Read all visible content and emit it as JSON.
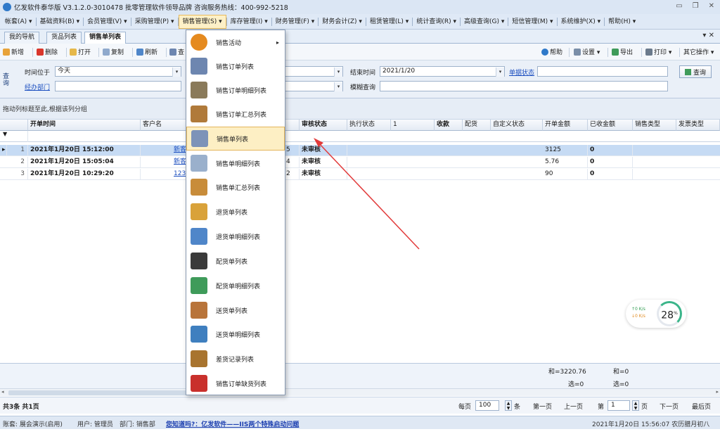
{
  "window": {
    "title": "亿发软件泰华版 V3.1.2.0-3010478 批零管理软件领导品牌 咨询服务热线：400-992-5218"
  },
  "menubar": {
    "items": [
      "帐套(A) ▾",
      "基础资料(B) ▾",
      "会员管理(V) ▾",
      "采购管理(P) ▾",
      "销售管理(S) ▾",
      "库存管理(I) ▾",
      "财务管理(F) ▾",
      "财务会计(Z) ▾",
      "租赁管理(L) ▾",
      "统计查询(R) ▾",
      "高级查询(G) ▾",
      "短信管理(M) ▾",
      "系统维护(X) ▾",
      "帮助(H) ▾"
    ]
  },
  "tabs": [
    "我的导航",
    "货品列表",
    "销售单列表"
  ],
  "toolbar": {
    "new": "新增",
    "delete": "删除",
    "open": "打开",
    "copy": "复制",
    "refresh": "刷新",
    "query": "查",
    "help": "帮助",
    "settings": "设置 ▾",
    "export": "导出",
    "print": "打印 ▾",
    "other": "其它操作 ▾"
  },
  "filter": {
    "side": "查询",
    "time_label": "时间位于",
    "time_value": "今天",
    "dept_link": "经办部门",
    "end_label": "结束时间",
    "end_value": "2021/1/20",
    "doc_status_link": "单据状态",
    "fuzzy_label": "模糊查询",
    "query_btn": "查询"
  },
  "grid": {
    "group_hint": "拖动列标题至此,根据该列分组",
    "headers": [
      "开单时间",
      "客户名",
      "审核状态",
      "执行状态",
      "1",
      "收款",
      "配货",
      "自定义状态",
      "开单金额",
      "已收金额",
      "销售类型",
      "发票类型"
    ],
    "rows": [
      {
        "num": "1",
        "time": "2021年1月20日 15:12:00",
        "customer": "新客",
        "code": "5",
        "audit": "未审核",
        "amount": "3125",
        "received": "0"
      },
      {
        "num": "2",
        "time": "2021年1月20日 15:05:04",
        "customer": "新客",
        "code": "4",
        "audit": "未审核",
        "amount": "5.76",
        "received": "0"
      },
      {
        "num": "3",
        "time": "2021年1月20日 10:29:20",
        "customer": "123",
        "code": "2",
        "audit": "未审核",
        "amount": "90",
        "received": "0"
      }
    ],
    "summary": {
      "sum_amount": "和=3220.76",
      "sel_amount": "选=0",
      "sum_received": "和=0",
      "sel_received": "选=0"
    }
  },
  "pager": {
    "records": "共3条 共1页",
    "per_page": "每页",
    "per_page_value": "100",
    "per_page_unit": "条",
    "first": "第一页",
    "prev": "上一页",
    "page_prefix": "第",
    "page_value": "1",
    "page_suffix": "页",
    "next": "下一页",
    "last": "最后页"
  },
  "statusbar": {
    "account": "账套: 展会演示(启用)",
    "user": "用户: 管理员",
    "dept": "部门: 销售部",
    "tip": "您知道吗?：亿发软件——IIS两个特殊启动问题",
    "datetime": "2021年1月20日 15:56:07 农历腊月初八"
  },
  "dropdown": {
    "items": [
      {
        "label": "销售活动",
        "icon": "special-offer-icon",
        "color": "#e58a1f",
        "arrow": "▸"
      },
      {
        "label": "销售订单列表",
        "icon": "order-list-icon",
        "color": "#6d86b0"
      },
      {
        "label": "销售订单明细列表",
        "icon": "order-detail-icon",
        "color": "#8a7a5a"
      },
      {
        "label": "销售订单汇总列表",
        "icon": "order-summary-icon",
        "color": "#b07a3a"
      },
      {
        "label": "销售单列表",
        "icon": "sales-list-icon",
        "color": "#7d93b8"
      },
      {
        "label": "销售单明细列表",
        "icon": "sales-detail-icon",
        "color": "#9ab0cc"
      },
      {
        "label": "销售单汇总列表",
        "icon": "sales-summary-icon",
        "color": "#c88c3a"
      },
      {
        "label": "退货单列表",
        "icon": "return-list-icon",
        "color": "#d9a23a"
      },
      {
        "label": "退货单明细列表",
        "icon": "return-detail-icon",
        "color": "#4f86c9"
      },
      {
        "label": "配货单列表",
        "icon": "delivery-list-icon",
        "color": "#3a3a3a"
      },
      {
        "label": "配货单明细列表",
        "icon": "delivery-detail-icon",
        "color": "#3f9b5a"
      },
      {
        "label": "送货单列表",
        "icon": "shipping-list-icon",
        "color": "#b8743a"
      },
      {
        "label": "送货单明细列表",
        "icon": "shipping-detail-icon",
        "color": "#3f7fbf"
      },
      {
        "label": "差货记录列表",
        "icon": "shortage-record-icon",
        "color": "#a8742f"
      },
      {
        "label": "销售订单缺货列表",
        "icon": "out-of-stock-icon",
        "color": "#c9302c"
      }
    ],
    "highlighted": "销售单列表"
  },
  "net_widget": {
    "up": "↑0  K/s",
    "down": "↓0  K/s",
    "percent": "28",
    "unit": "%"
  }
}
